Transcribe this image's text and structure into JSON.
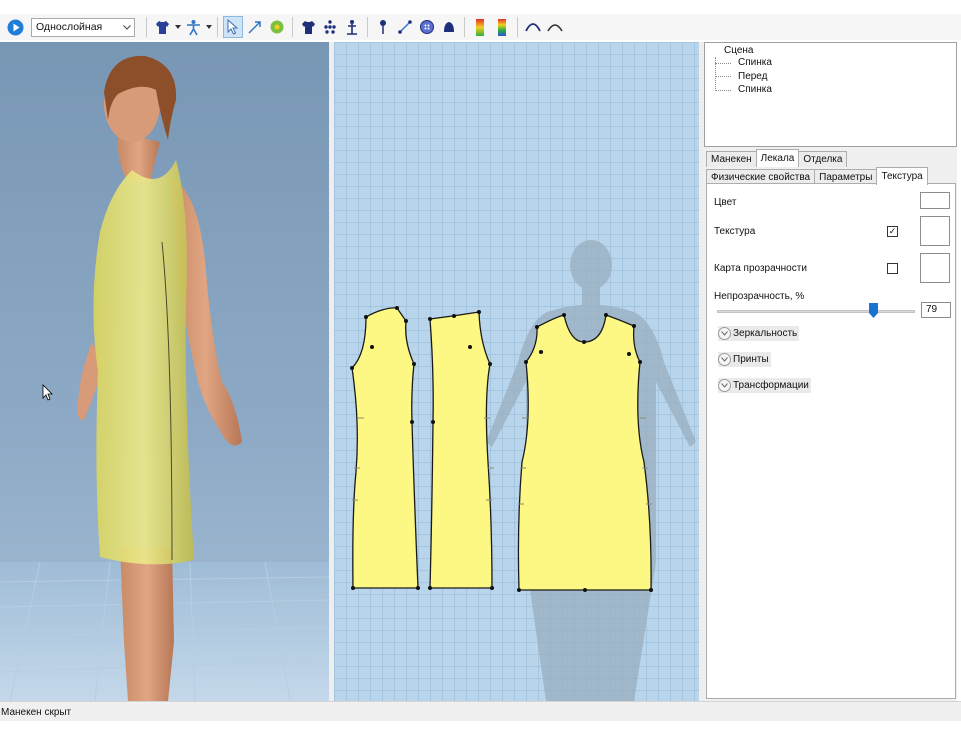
{
  "toolbar": {
    "layer_mode_value": "Однослойная",
    "icons": [
      "play-icon",
      "shirt-icon",
      "mannequin-icon",
      "pointer-icon",
      "arrow-tool-icon",
      "gear-flower-icon",
      "garment-icon",
      "points-icon",
      "measure-person-icon",
      "pin-icon",
      "line-tool-icon",
      "button-icon",
      "bell-icon",
      "heatmap-gradient-icon",
      "fit-heatmap-icon",
      "curve-down-icon",
      "curve-up-icon"
    ],
    "colors": {
      "play": "#1f7fd8",
      "shirt": "#2a3f9a",
      "accent": "#2f75c8"
    }
  },
  "scene_tree": {
    "root": "Сцена",
    "children": [
      "Спинка",
      "Перед",
      "Спинка"
    ]
  },
  "main_tabs": [
    {
      "label": "Манекен",
      "active": false
    },
    {
      "label": "Лекала",
      "active": true
    },
    {
      "label": "Отделка",
      "active": false
    }
  ],
  "sub_tabs": [
    {
      "label": "Физические свойства",
      "active": false
    },
    {
      "label": "Параметры",
      "active": false
    },
    {
      "label": "Текстура",
      "active": true
    }
  ],
  "properties": {
    "color_label": "Цвет",
    "texture_label": "Текстура",
    "texture_checked": true,
    "transparency_map_label": "Карта прозрачности",
    "transparency_map_checked": false,
    "opacity_label": "Непрозрачность, %",
    "opacity_value": "79",
    "opacity_fraction": 0.79,
    "sections": [
      "Зеркальность",
      "Принты",
      "Трансформации"
    ]
  },
  "status": {
    "text": "Манекен скрыт"
  },
  "colors": {
    "pattern_fill": "#fcf883",
    "dress_fill": "#e0dd6a",
    "grid_bg": "#b9d5ec",
    "viewport_bg": "#8eaac6"
  }
}
